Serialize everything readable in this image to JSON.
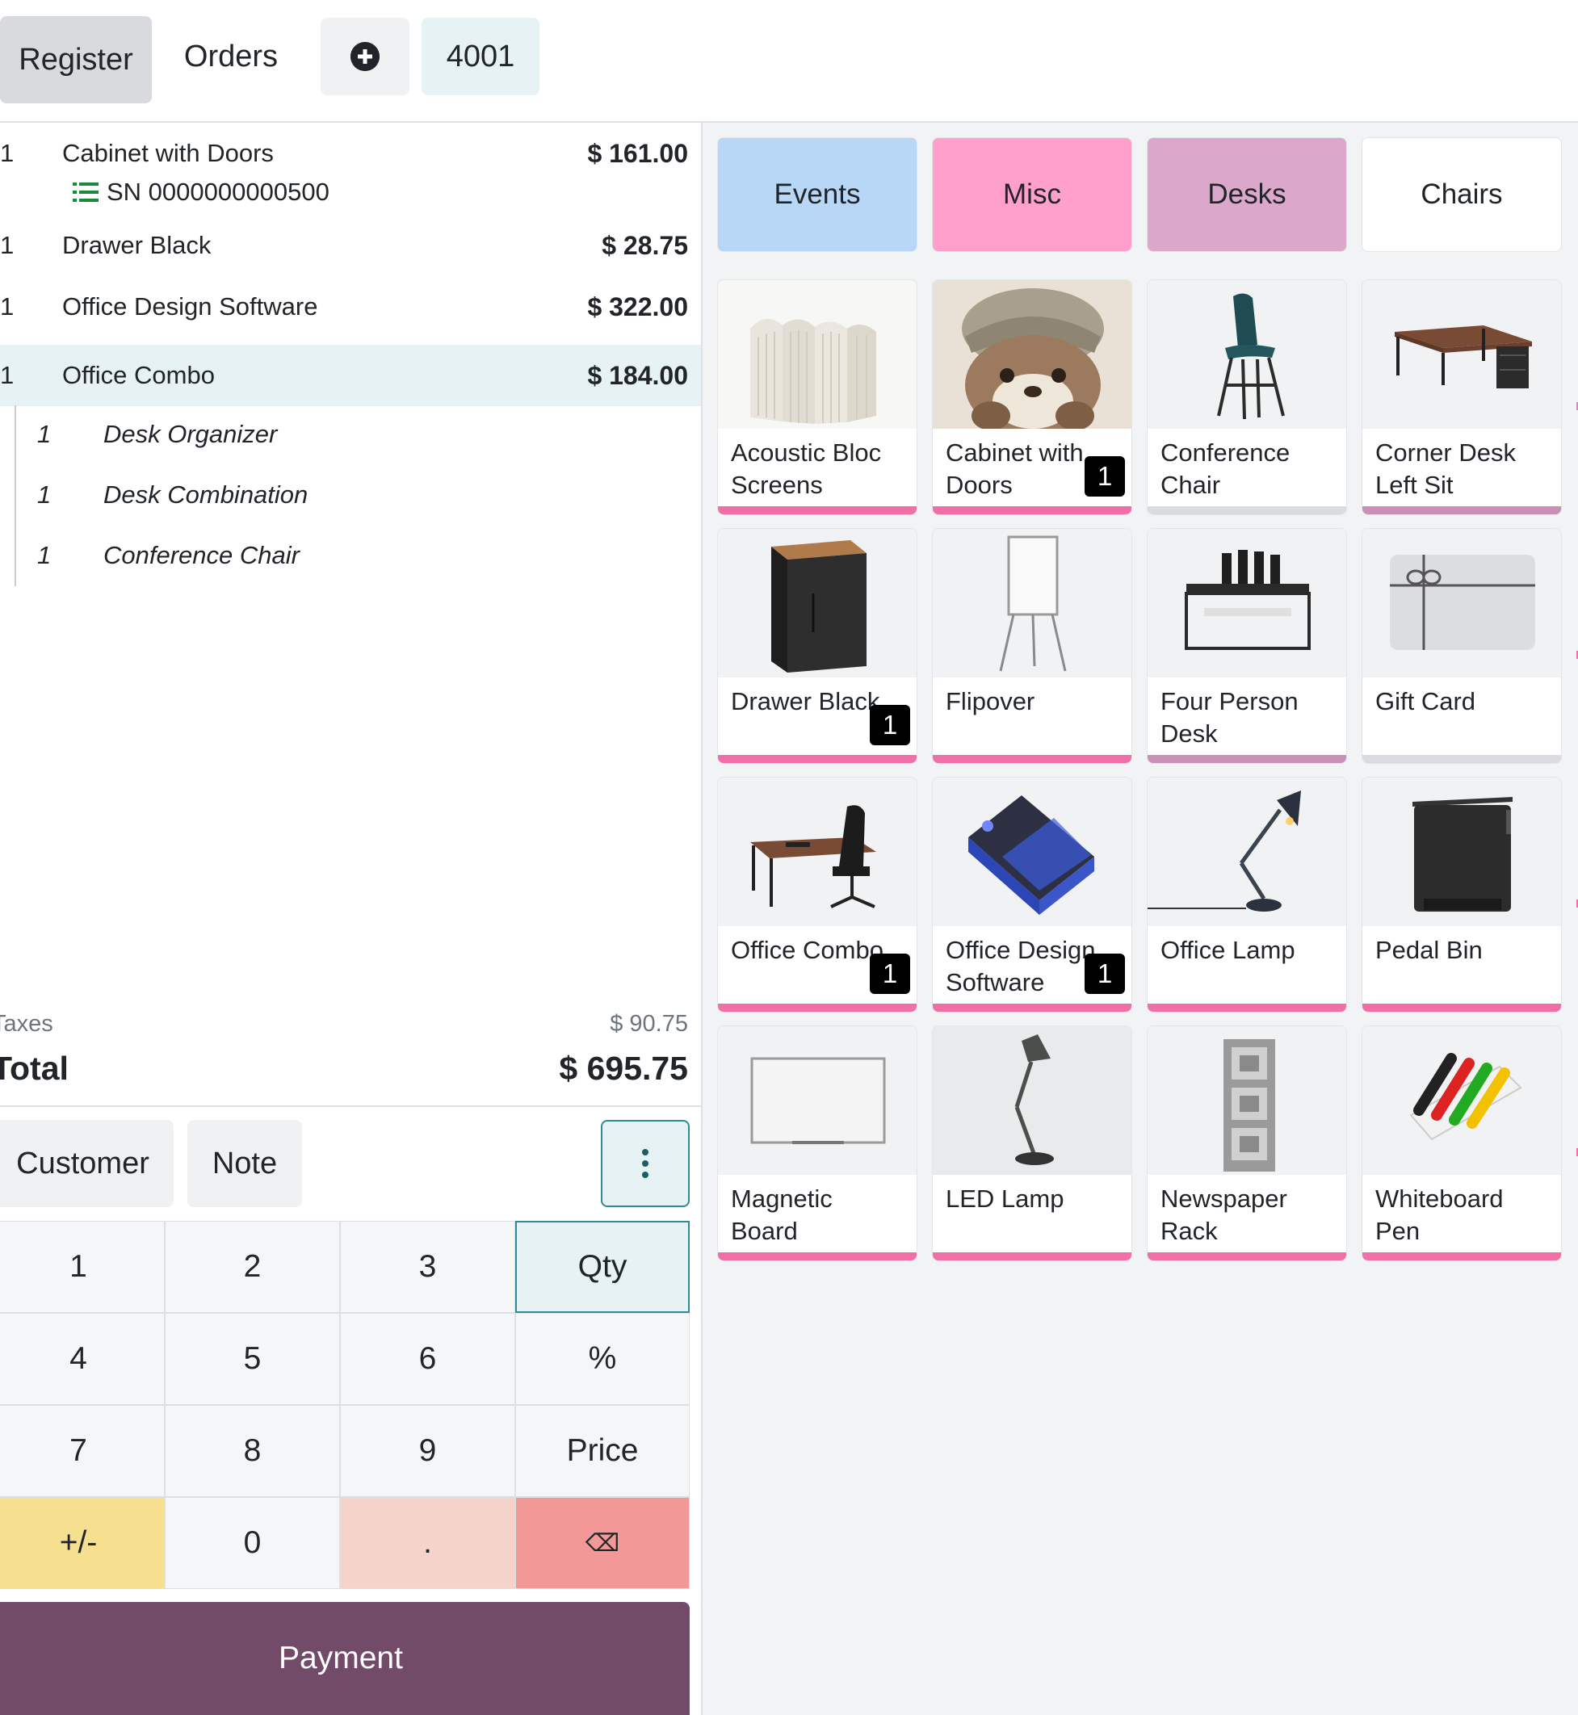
{
  "topbar": {
    "register_label": "Register",
    "orders_label": "Orders",
    "add_icon": "plus-circle-icon",
    "order_number": "4001"
  },
  "order": {
    "lines": [
      {
        "qty": "1",
        "name": "Cabinet with Doors",
        "price": "$ 161.00",
        "serial": "SN 0000000000500"
      },
      {
        "qty": "1",
        "name": "Drawer Black",
        "price": "$ 28.75"
      },
      {
        "qty": "1",
        "name": "Office Design Software",
        "price": "$ 322.00"
      },
      {
        "qty": "1",
        "name": "Office Combo",
        "price": "$ 184.00",
        "selected": true
      }
    ],
    "combo_items": [
      {
        "qty": "1",
        "name": "Desk Organizer"
      },
      {
        "qty": "1",
        "name": "Desk Combination"
      },
      {
        "qty": "1",
        "name": "Conference Chair"
      }
    ],
    "taxes_label": "Taxes",
    "taxes_value": "$ 90.75",
    "total_label": "Total",
    "total_value": "$ 695.75"
  },
  "controls": {
    "customer_label": "Customer",
    "note_label": "Note",
    "more_icon": "vertical-dots-icon"
  },
  "numpad": {
    "keys": [
      "1",
      "2",
      "3",
      "Qty",
      "4",
      "5",
      "6",
      "%",
      "7",
      "8",
      "9",
      "Price",
      "+/-",
      "0",
      ".",
      "⌫"
    ],
    "active_mode": "Qty"
  },
  "payment_label": "Payment",
  "categories": [
    {
      "label": "Events",
      "color": "#b8d6f5"
    },
    {
      "label": "Misc",
      "color": "#ff9fcb"
    },
    {
      "label": "Desks",
      "color": "#dba8cc"
    },
    {
      "label": "Chairs",
      "color": "#ffffff"
    }
  ],
  "products": [
    {
      "name": "Acoustic Bloc Screens",
      "badge": null,
      "bar_color": "#f06fa6",
      "icon": "acoustic-screens-image"
    },
    {
      "name": "Cabinet with Doors",
      "badge": "1",
      "bar_color": "#f06fa6",
      "icon": "otter-image"
    },
    {
      "name": "Conference Chair",
      "badge": null,
      "bar_color": "#d9dbde",
      "icon": "chair-image"
    },
    {
      "name": "Corner Desk Left Sit",
      "badge": null,
      "bar_color": "#c98fb6",
      "icon": "corner-desk-image"
    },
    {
      "name": "Drawer Black",
      "badge": "1",
      "bar_color": "#f06fa6",
      "icon": "drawer-image"
    },
    {
      "name": "Flipover",
      "badge": null,
      "bar_color": "#f06fa6",
      "icon": "flipchart-image"
    },
    {
      "name": "Four Person Desk",
      "badge": null,
      "bar_color": "#c98fb6",
      "icon": "four-person-desk-image"
    },
    {
      "name": "Gift Card",
      "badge": null,
      "bar_color": "#d9dbde",
      "icon": "gift-card-image"
    },
    {
      "name": "Office Combo",
      "badge": "1",
      "bar_color": "#f06fa6",
      "icon": "office-combo-image"
    },
    {
      "name": "Office Design Software",
      "badge": "1",
      "bar_color": "#f06fa6",
      "icon": "software-box-image"
    },
    {
      "name": "Office Lamp",
      "badge": null,
      "bar_color": "#f06fa6",
      "icon": "office-lamp-image"
    },
    {
      "name": "Pedal Bin",
      "badge": null,
      "bar_color": "#f06fa6",
      "icon": "pedal-bin-image"
    },
    {
      "name": "Magnetic Board",
      "badge": null,
      "bar_color": "#f06fa6",
      "icon": "magnetic-board-image"
    },
    {
      "name": "LED Lamp",
      "badge": null,
      "bar_color": "#f06fa6",
      "icon": "led-lamp-image"
    },
    {
      "name": "Newspaper Rack",
      "badge": null,
      "bar_color": "#f06fa6",
      "icon": "newspaper-rack-image"
    },
    {
      "name": "Whiteboard Pen",
      "badge": null,
      "bar_color": "#f06fa6",
      "icon": "whiteboard-pen-image"
    }
  ]
}
